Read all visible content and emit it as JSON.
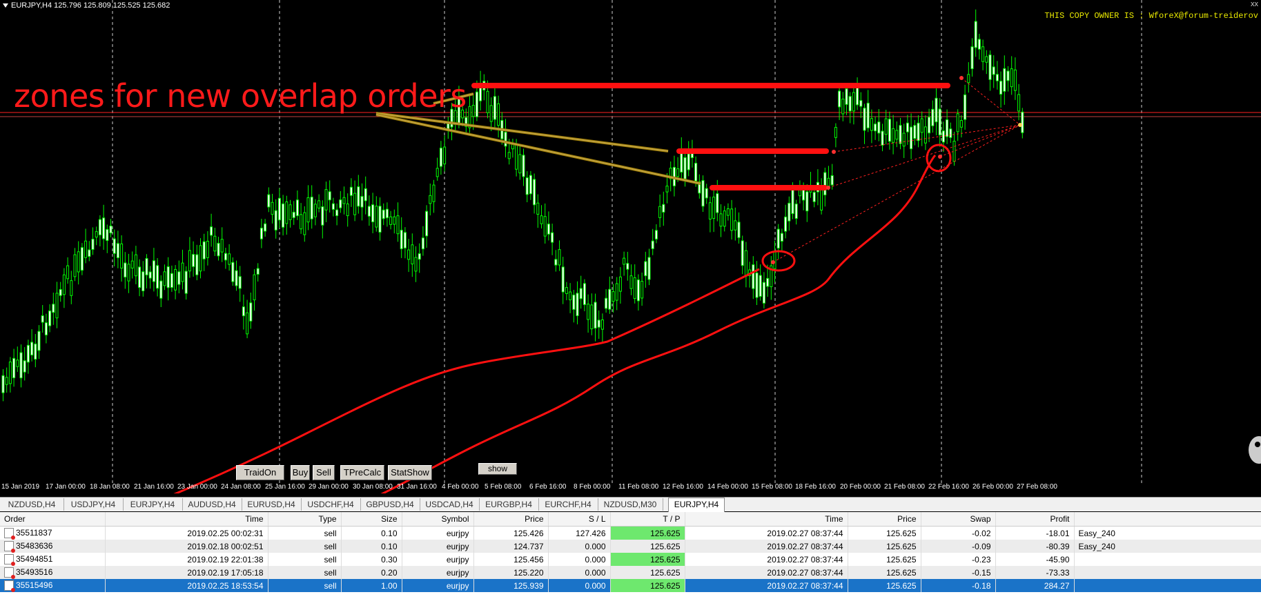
{
  "chart": {
    "header": "EURJPY,H4  125.796 125.809 125.525 125.682",
    "owner": "THIS COPY OWNER IS : WforeX@forum-treiderov",
    "close_glyph": "xx",
    "annotation": "zones for new overlap orders",
    "x_labels": [
      "15 Jan 2019",
      "17 Jan 00:00",
      "18 Jan 08:00",
      "21 Jan 16:00",
      "23 Jan 00:00",
      "24 Jan 08:00",
      "25 Jan 16:00",
      "29 Jan 00:00",
      "30 Jan 08:00",
      "31 Jan 16:00",
      "4 Feb 00:00",
      "5 Feb 08:00",
      "6 Feb 16:00",
      "8 Feb 00:00",
      "11 Feb 08:00",
      "12 Feb 16:00",
      "14 Feb 00:00",
      "15 Feb 08:00",
      "18 Feb 16:00",
      "20 Feb 00:00",
      "21 Feb 08:00",
      "22 Feb 16:00",
      "26 Feb 00:00",
      "27 Feb 08:00"
    ],
    "buttons": {
      "traidon": "TraidOn",
      "buy": "Buy",
      "sell": "Sell",
      "tprecalc": "TPreCalc",
      "statshow": "StatShow",
      "show": "show"
    },
    "colors": {
      "candle": "#00ff00",
      "annotation": "#ff1a1a",
      "price_line": "#ff2020"
    }
  },
  "tabs": [
    "NZDUSD,H4",
    "USDJPY,H4",
    "EURJPY,H4",
    "AUDUSD,H4",
    "EURUSD,H4",
    "USDCHF,H4",
    "GBPUSD,H4",
    "USDCAD,H4",
    "EURGBP,H4",
    "EURCHF,H4",
    "NZDUSD,M30",
    "EURJPY,H4"
  ],
  "active_tab": "EURJPY,H4",
  "orders": {
    "headers": [
      "Order",
      "Time",
      "Type",
      "Size",
      "Symbol",
      "Price",
      "S / L",
      "T / P",
      "Time",
      "Price",
      "Swap",
      "Profit",
      ""
    ],
    "rows": [
      [
        "35511837",
        "2019.02.25 00:02:31",
        "sell",
        "0.10",
        "eurjpy",
        "125.426",
        "127.426",
        "125.625",
        "2019.02.27 08:37:44",
        "125.625",
        "-0.02",
        "-18.01",
        "Easy_240"
      ],
      [
        "35483636",
        "2019.02.18 00:02:51",
        "sell",
        "0.10",
        "eurjpy",
        "124.737",
        "0.000",
        "125.625",
        "2019.02.27 08:37:44",
        "125.625",
        "-0.09",
        "-80.39",
        "Easy_240"
      ],
      [
        "35494851",
        "2019.02.19 22:01:38",
        "sell",
        "0.30",
        "eurjpy",
        "125.456",
        "0.000",
        "125.625",
        "2019.02.27 08:37:44",
        "125.625",
        "-0.23",
        "-45.90",
        ""
      ],
      [
        "35493516",
        "2019.02.19 17:05:18",
        "sell",
        "0.20",
        "eurjpy",
        "125.220",
        "0.000",
        "125.625",
        "2019.02.27 08:37:44",
        "125.625",
        "-0.15",
        "-73.33",
        ""
      ],
      [
        "35515496",
        "2019.02.25 18:53:54",
        "sell",
        "1.00",
        "eurjpy",
        "125.939",
        "0.000",
        "125.625",
        "2019.02.27 08:37:44",
        "125.625",
        "-0.18",
        "284.27",
        ""
      ]
    ]
  }
}
